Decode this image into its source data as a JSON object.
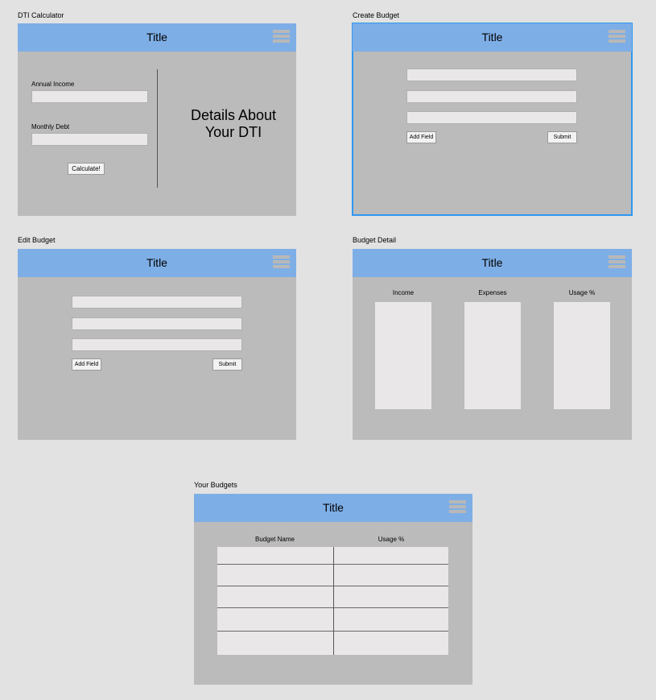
{
  "frames": {
    "dti": {
      "label": "DTI Calculator",
      "title": "Title",
      "annual_income_label": "Annual Income",
      "monthly_debt_label": "Monthly Debt",
      "calculate_button": "Calculate!",
      "details_line1": "Details About",
      "details_line2": "Your DTI"
    },
    "create": {
      "label": "Create Budget",
      "title": "Title",
      "add_field_button": "Add Field",
      "submit_button": "Submit"
    },
    "edit": {
      "label": "Edit Budget",
      "title": "Title",
      "add_field_button": "Add Field",
      "submit_button": "Submit"
    },
    "detail": {
      "label": "Budget Detail",
      "title": "Title",
      "columns": [
        "Income",
        "Expenses",
        "Usage %"
      ]
    },
    "yours": {
      "label": "Your Budgets",
      "title": "Title",
      "columns": [
        "Budget Name",
        "Usage %"
      ]
    }
  },
  "colors": {
    "titlebar": "#7eaee6",
    "frame_bg": "#bbbbbb",
    "selection": "#2f97f1"
  },
  "icons": {
    "menu": "hamburger-menu-icon"
  }
}
